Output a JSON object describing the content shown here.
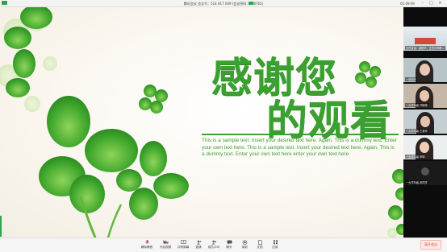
{
  "titlebar": {
    "title": "腾讯会议  会议号：514 617 049  (会议密码：898765)",
    "time": "01:09:09",
    "minimize_icon": "minimize-icon",
    "maximize_icon": "maximize-icon",
    "close_icon": "close-icon"
  },
  "slide": {
    "line1": "感谢您",
    "line2": "的观看",
    "body": "This is a sample text. Insert your desired text here. Again. This is a dummy text. Enter your own text here. This is a sample text. Insert your desired text here. Again. This is a dummy text. Enter your own text here enter your own text here",
    "accent_color": "#3aa130",
    "decoration": "clover-illustration"
  },
  "participants": [
    {
      "name": "正在讲话：凌阳华；正在共享屏..."
    },
    {
      "name": "一米阳光"
    },
    {
      "name": "一大学年级-刘娟娟"
    },
    {
      "name": "一大学年级-王老师"
    },
    {
      "name": "一大学年级-李明"
    },
    {
      "name": "一大学年级-张同学"
    }
  ],
  "toolbar": {
    "items": [
      {
        "label": "解除静音",
        "icon": "microphone-icon"
      },
      {
        "label": "开启视频",
        "icon": "camera-icon"
      },
      {
        "label": "共享屏幕",
        "icon": "share-screen-icon"
      },
      {
        "label": "邀请",
        "icon": "invite-icon"
      },
      {
        "label": "成员(35)",
        "icon": "members-icon"
      },
      {
        "label": "聊天",
        "icon": "chat-icon"
      },
      {
        "label": "录制",
        "icon": "record-icon"
      },
      {
        "label": "文档",
        "icon": "document-icon"
      },
      {
        "label": "应用",
        "icon": "apps-icon"
      }
    ],
    "end_label": "离开会议"
  }
}
